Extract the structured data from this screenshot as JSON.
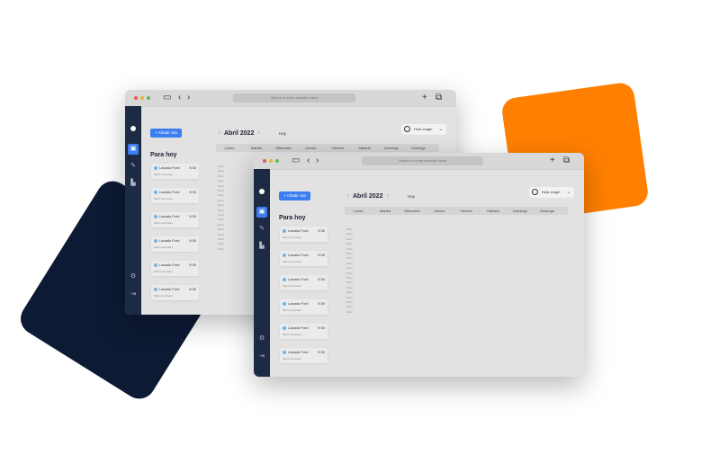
{
  "colors": {
    "accent": "#3c7ef0",
    "sidebar": "#1c2a44",
    "decor_orange": "#ff7f00",
    "decor_navy": "#0d1a33",
    "window_bg": "#e2e2e2"
  },
  "browser": {
    "url_placeholder": "Search or enter website name",
    "icons": [
      "sidebar-toggle-icon",
      "back-icon",
      "forward-icon",
      "new-tab-icon",
      "tabs-icon"
    ]
  },
  "sidebar": {
    "items": [
      {
        "icon": "calendar-icon",
        "active": true
      },
      {
        "icon": "wrench-icon",
        "active": false
      },
      {
        "icon": "factory-icon",
        "active": false
      }
    ],
    "bottom": [
      {
        "icon": "gear-icon"
      },
      {
        "icon": "logout-icon"
      }
    ]
  },
  "app": {
    "add_button": "+ Añadir cita",
    "section_title": "Para hoy",
    "month": "Abril 2022",
    "today_button": "Hoy",
    "user": "Hola Jorge!",
    "weekdays": [
      "Lunes",
      "Martes",
      "Miercoles",
      "Jueves",
      "Viernes",
      "Sábado",
      "Domingo",
      "Domingo"
    ],
    "hours": [
      "8 am",
      "8 am",
      "8 am",
      "8 am",
      "8 am",
      "8 am",
      "8 am",
      "8 am",
      "8 am",
      "8 am",
      "8 am",
      "8 am",
      "8 am",
      "8 am",
      "8 am",
      "8 am",
      "8 am",
      "8 am"
    ]
  },
  "tasks": [
    {
      "title": "Lavado Ford",
      "time": "9:30",
      "subtitle": "Mario Gonzalez"
    },
    {
      "title": "Lavado Ford",
      "time": "9:30",
      "subtitle": "Mario Gonzalez"
    },
    {
      "title": "Lavado Ford",
      "time": "9:30",
      "subtitle": "Mario Gonzalez"
    },
    {
      "title": "Lavado Ford",
      "time": "9:30",
      "subtitle": "Mario Gonzalez"
    },
    {
      "title": "Lavado Ford",
      "time": "9:30",
      "subtitle": "Mario Gonzalez"
    },
    {
      "title": "Lavado Ford",
      "time": "9:30",
      "subtitle": "Mario Gonzalez"
    }
  ]
}
